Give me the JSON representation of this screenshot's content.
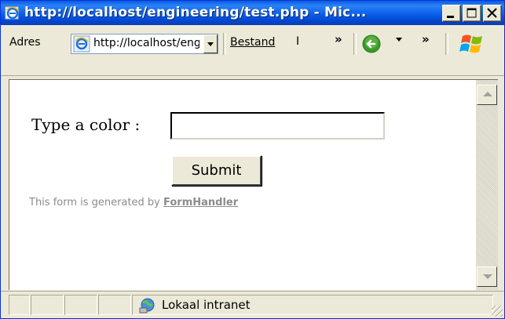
{
  "window": {
    "title": "http://localhost/engineering/test.php - Mic...",
    "buttons": [
      "minimize",
      "maximize",
      "close"
    ]
  },
  "toolbar": {
    "address_label": "Adres",
    "address_value": "http://localhost/engineering/test.php",
    "menu_bestand": "Bestand",
    "menu_pipe": "I",
    "chevron": "»"
  },
  "form": {
    "label": "Type a color :",
    "input_value": "",
    "submit_label": "Submit",
    "credit_prefix": "This form is generated by ",
    "credit_link": "FormHandler"
  },
  "statusbar": {
    "zone_text": "Lokaal intranet"
  },
  "colors": {
    "titlebar": "#0a5ae0",
    "chrome": "#ece9d8",
    "credit_text": "#8c8c8c"
  },
  "icons": {
    "title_icon": "ie-icon",
    "address_icon": "ie-page-icon",
    "back": "back-arrow-icon",
    "brand": "windows-logo-icon",
    "zone": "intranet-globe-icon"
  }
}
